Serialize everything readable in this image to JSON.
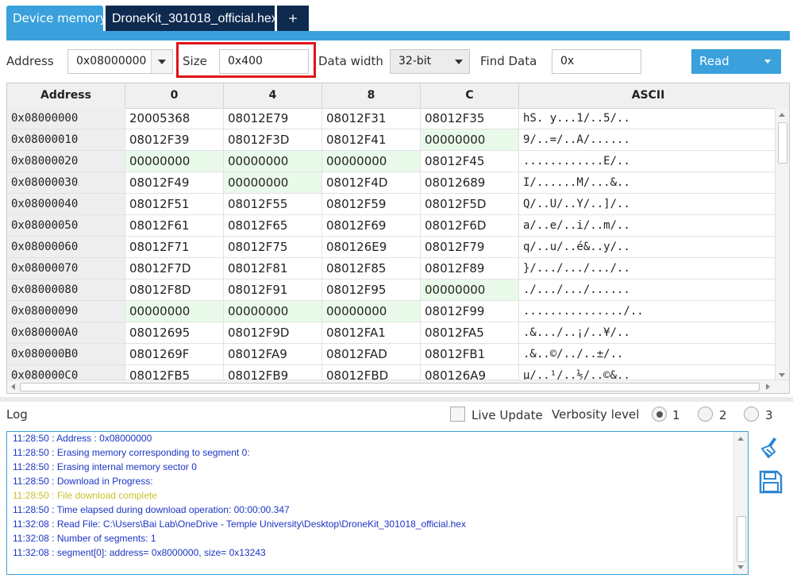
{
  "tabs": {
    "device_memory": "Device memory",
    "file": "DroneKit_301018_official.hex",
    "add": "+"
  },
  "controls": {
    "address_label": "Address",
    "address_value": "0x08000000",
    "size_label": "Size",
    "size_value": "0x400",
    "data_width_label": "Data width",
    "data_width_value": "32-bit",
    "find_data_label": "Find Data",
    "find_data_value": "0x",
    "read_label": "Read"
  },
  "table": {
    "headers": [
      "Address",
      "0",
      "4",
      "8",
      "C",
      "ASCII"
    ],
    "rows": [
      [
        "0x08000000",
        "20005368",
        "08012E79",
        "08012F31",
        "08012F35",
        "hS. y...1/..5/.."
      ],
      [
        "0x08000010",
        "08012F39",
        "08012F3D",
        "08012F41",
        "00000000",
        "9/..=/..A/......"
      ],
      [
        "0x08000020",
        "00000000",
        "00000000",
        "00000000",
        "08012F45",
        "............E/.."
      ],
      [
        "0x08000030",
        "08012F49",
        "00000000",
        "08012F4D",
        "08012689",
        "I/......M/...&.."
      ],
      [
        "0x08000040",
        "08012F51",
        "08012F55",
        "08012F59",
        "08012F5D",
        "Q/..U/..Y/..]/.."
      ],
      [
        "0x08000050",
        "08012F61",
        "08012F65",
        "08012F69",
        "08012F6D",
        "a/..e/..i/..m/.."
      ],
      [
        "0x08000060",
        "08012F71",
        "08012F75",
        "080126E9",
        "08012F79",
        "q/..u/..é&..y/.."
      ],
      [
        "0x08000070",
        "08012F7D",
        "08012F81",
        "08012F85",
        "08012F89",
        "}/.../.../.../.."
      ],
      [
        "0x08000080",
        "08012F8D",
        "08012F91",
        "08012F95",
        "00000000",
        "./.../.../......"
      ],
      [
        "0x08000090",
        "00000000",
        "00000000",
        "00000000",
        "08012F99",
        ".............../.."
      ],
      [
        "0x080000A0",
        "08012695",
        "08012F9D",
        "08012FA1",
        "08012FA5",
        ".&.../..¡/..¥/.."
      ],
      [
        "0x080000B0",
        "0801269F",
        "08012FA9",
        "08012FAD",
        "08012FB1",
        ".&..©/../..±/.."
      ],
      [
        "0x080000C0",
        "08012FB5",
        "08012FB9",
        "08012FBD",
        "080126A9",
        "µ/..¹/..½/..©&.."
      ]
    ]
  },
  "log": {
    "label": "Log",
    "live_update_label": "Live Update",
    "verbosity_label": "Verbosity level",
    "verbosity_options": [
      "1",
      "2",
      "3"
    ],
    "verbosity_selected": "1",
    "lines": [
      "11:28:50 :  Address      : 0x08000000",
      "11:28:50 : Erasing memory corresponding to segment 0:",
      "11:28:50 : Erasing internal memory sector 0",
      "11:28:50 : Download in Progress:",
      "11:28:50 : File download complete",
      "11:28:50 : Time elapsed during download operation: 00:00:00.347",
      "11:32:08 : Read File: C:\\Users\\Bai Lab\\OneDrive - Temple University\\Desktop\\DroneKit_301018_official.hex",
      "11:32:08 : Number of segments: 1",
      "11:32:08 : segment[0]: address= 0x8000000, size= 0x13243"
    ]
  },
  "colors": {
    "accent": "#3aa1dd",
    "dark_tab": "#0f2a4f",
    "zero_cell": "#eafaea",
    "highlight": "#e0131a",
    "log_text": "#1c35c4",
    "log_done": "#c6c42a"
  }
}
